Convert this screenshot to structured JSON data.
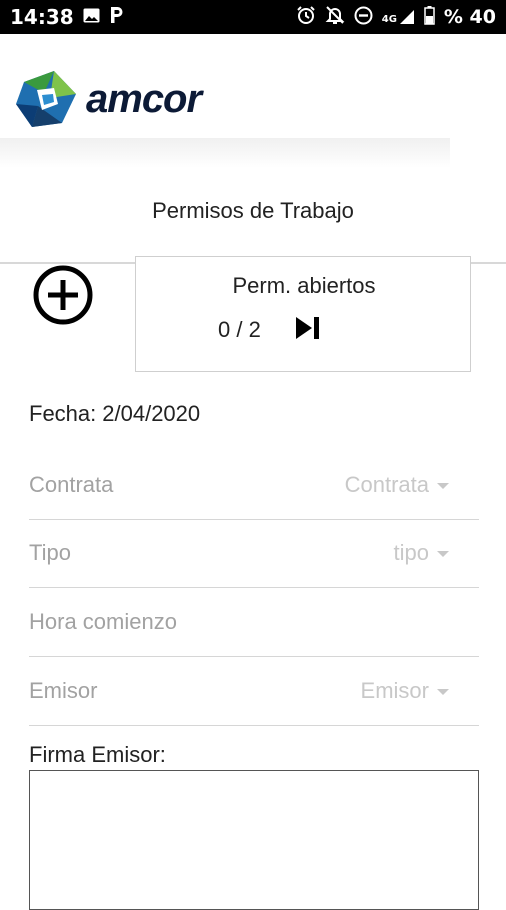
{
  "status_bar": {
    "time": "14:38",
    "left_icons": [
      "image-icon",
      "parking-icon"
    ],
    "right_icons": [
      "alarm-icon",
      "notifications-off-icon",
      "do-not-disturb-icon",
      "signal-4g-icon",
      "battery-icon"
    ],
    "network": "4G",
    "battery": "% 40"
  },
  "header": {
    "logo_text": "amcor",
    "title": "Permisos de Trabajo"
  },
  "permits": {
    "label": "Perm. abiertos",
    "count": "0 / 2"
  },
  "form": {
    "fecha_label": "Fecha:",
    "fecha_value": "2/04/2020",
    "fields": [
      {
        "label": "Contrata",
        "select": "Contrata"
      },
      {
        "label": "Tipo",
        "select": "tipo"
      },
      {
        "label": "Hora comienzo"
      },
      {
        "label": "Emisor",
        "select": "Emisor"
      }
    ],
    "firma_label": "Firma Emisor:"
  },
  "colors": {
    "status_bar_bg": "#000000",
    "logo_text": "#0c1a36",
    "logo_blue": "#1f6fb0",
    "logo_green": "#3a9a3e",
    "placeholder_text": "#a2a2a2",
    "divider": "#d6d6d6"
  }
}
